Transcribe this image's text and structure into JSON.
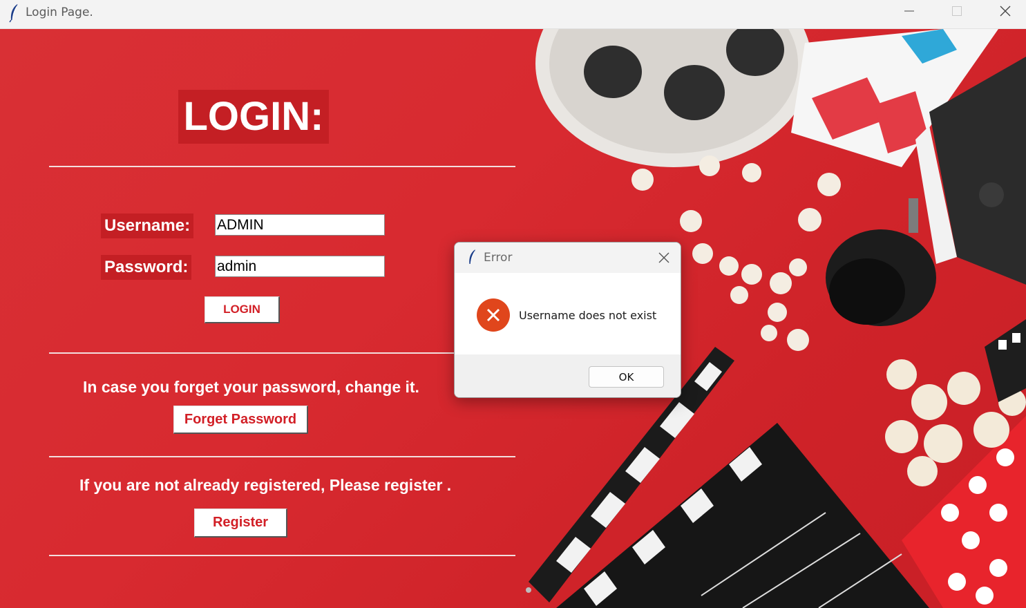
{
  "window": {
    "title": "Login Page.",
    "icon": "feather-icon",
    "controls": [
      "minimize-icon",
      "maximize-icon",
      "close-icon"
    ]
  },
  "login": {
    "heading": "LOGIN:",
    "username_label": "Username:",
    "username_value": "ADMIN",
    "password_label": "Password:",
    "password_value": "admin",
    "login_button": "LOGIN"
  },
  "forgot": {
    "text": "In case you forget your password, change it.",
    "button": "Forget Password"
  },
  "register": {
    "text": "If you are not already registered, Please register .",
    "button": "Register"
  },
  "dialog": {
    "title": "Error",
    "message": "Username does not exist",
    "ok_button": "OK",
    "icon": "error-icon"
  },
  "colors": {
    "background_red": "#d82a30",
    "label_bg": "#c41f24",
    "button_text": "#d21f26",
    "error_icon": "#e0461c"
  }
}
